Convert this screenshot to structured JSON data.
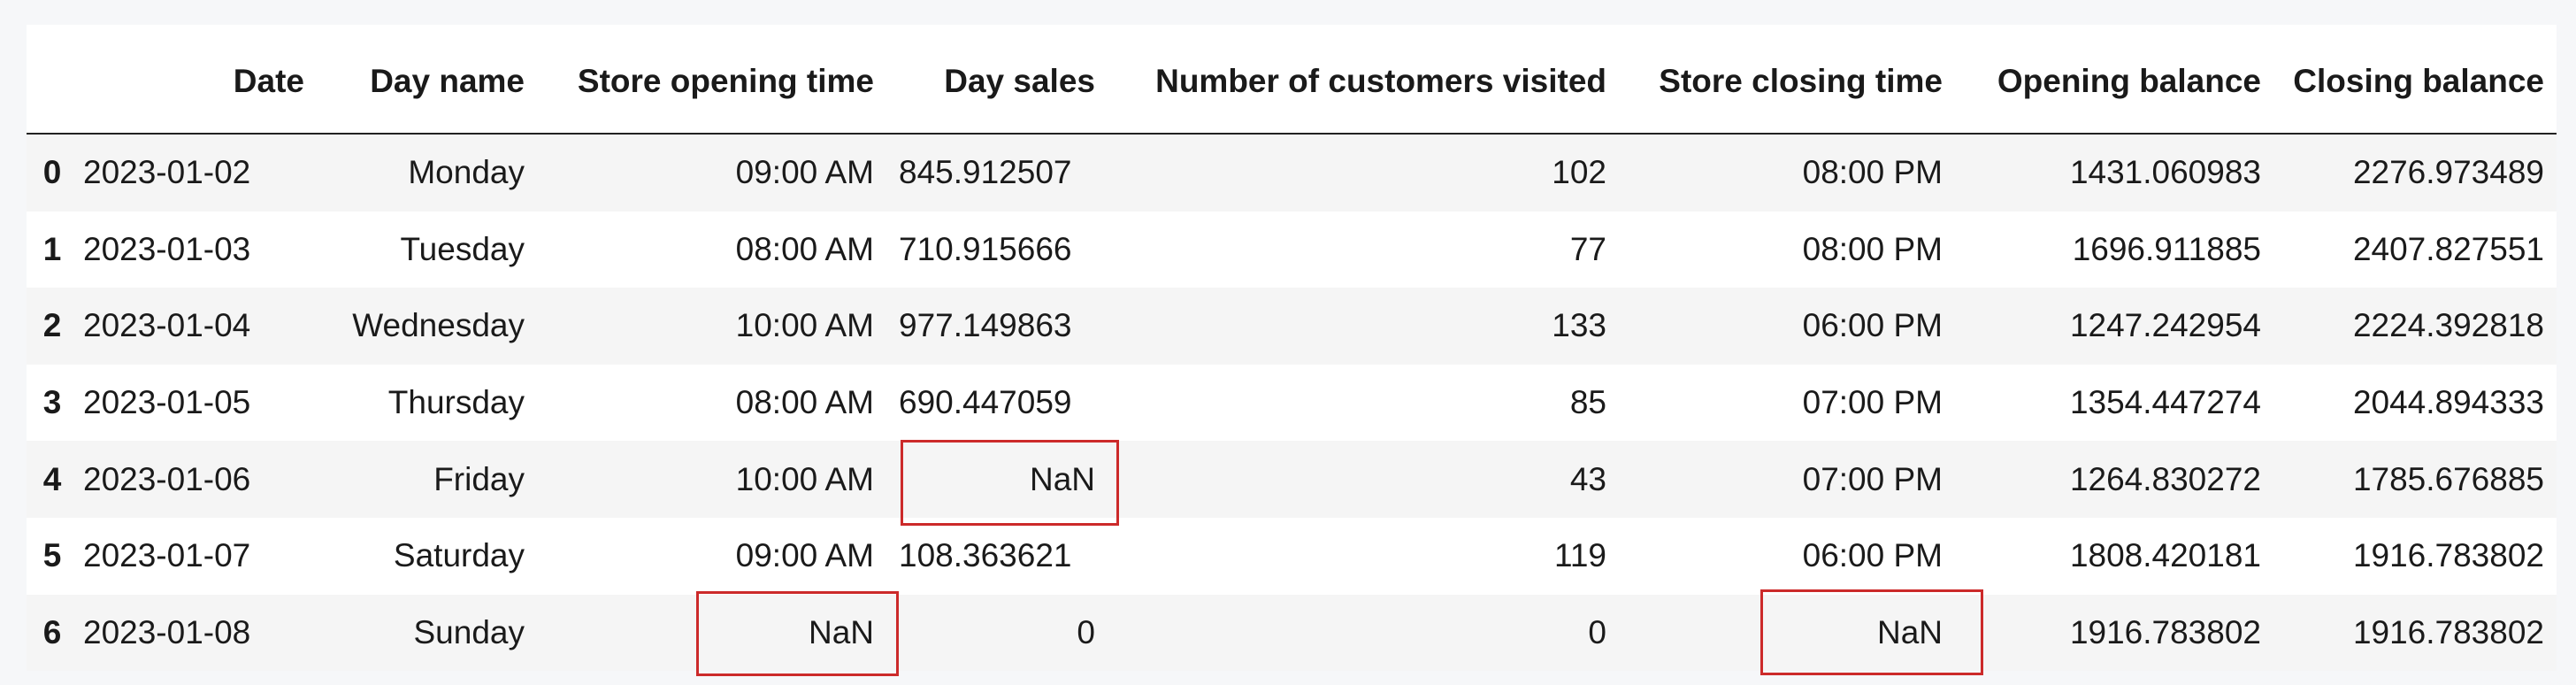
{
  "table": {
    "columns": [
      "",
      "Date",
      "Day name",
      "Store opening time",
      "Day sales",
      "Number of customers visited",
      "Store closing time",
      "Opening balance",
      "Closing balance"
    ],
    "rows": [
      {
        "index": "0",
        "date": "2023-01-02",
        "day_name": "Monday",
        "open_time": "09:00 AM",
        "day_sales": "845.912507",
        "customers": "102",
        "close_time": "08:00 PM",
        "opening_balance": "1431.060983",
        "closing_balance": "2276.973489"
      },
      {
        "index": "1",
        "date": "2023-01-03",
        "day_name": "Tuesday",
        "open_time": "08:00 AM",
        "day_sales": "710.915666",
        "customers": "77",
        "close_time": "08:00 PM",
        "opening_balance": "1696.911885",
        "closing_balance": "2407.827551"
      },
      {
        "index": "2",
        "date": "2023-01-04",
        "day_name": "Wednesday",
        "open_time": "10:00 AM",
        "day_sales": "977.149863",
        "customers": "133",
        "close_time": "06:00 PM",
        "opening_balance": "1247.242954",
        "closing_balance": "2224.392818"
      },
      {
        "index": "3",
        "date": "2023-01-05",
        "day_name": "Thursday",
        "open_time": "08:00 AM",
        "day_sales": "690.447059",
        "customers": "85",
        "close_time": "07:00 PM",
        "opening_balance": "1354.447274",
        "closing_balance": "2044.894333"
      },
      {
        "index": "4",
        "date": "2023-01-06",
        "day_name": "Friday",
        "open_time": "10:00 AM",
        "day_sales": "NaN",
        "customers": "43",
        "close_time": "07:00 PM",
        "opening_balance": "1264.830272",
        "closing_balance": "1785.676885"
      },
      {
        "index": "5",
        "date": "2023-01-07",
        "day_name": "Saturday",
        "open_time": "09:00 AM",
        "day_sales": "108.363621",
        "customers": "119",
        "close_time": "06:00 PM",
        "opening_balance": "1808.420181",
        "closing_balance": "1916.783802"
      },
      {
        "index": "6",
        "date": "2023-01-08",
        "day_name": "Sunday",
        "open_time": "NaN",
        "day_sales": "0",
        "customers": "0",
        "close_time": "NaN",
        "opening_balance": "1916.783802",
        "closing_balance": "1916.783802"
      }
    ],
    "highlight_color": "#cc2a2a",
    "stripe_color": "#f5f5f5"
  }
}
